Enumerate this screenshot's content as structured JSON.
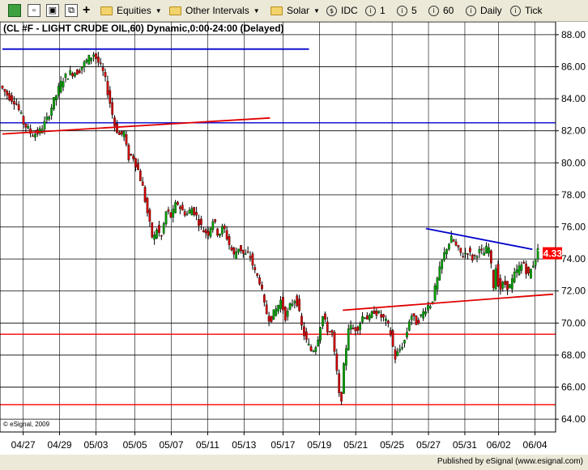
{
  "toolbar": {
    "equities": "Equities",
    "other_intervals": "Other Intervals",
    "solar": "Solar",
    "idc": "IDC",
    "int1": "1",
    "int5": "5",
    "int60": "60",
    "daily": "Daily",
    "tick": "Tick"
  },
  "footer": {
    "publisher": "Published by eSignal (www.esignal.com)"
  },
  "chart_data": {
    "type": "candlestick",
    "title": "(CL #F - LIGHT CRUDE OIL,60) Dynamic,0:00-24:00 (Delayed)",
    "copyright": "© eSignal, 2009",
    "last_price": "74.33",
    "ylim": [
      63.2,
      88.8
    ],
    "yticks": [
      "64.00",
      "66.00",
      "68.00",
      "70.00",
      "72.00",
      "74.00",
      "76.00",
      "78.00",
      "80.00",
      "82.00",
      "84.00",
      "86.00",
      "88.00"
    ],
    "xticks": [
      "04/27",
      "04/29",
      "05/03",
      "05/05",
      "05/07",
      "05/11",
      "05/13",
      "05/17",
      "05/19",
      "05/21",
      "05/25",
      "05/27",
      "05/31",
      "06/02",
      "06/04"
    ],
    "grid": true,
    "colors": {
      "up": "#00a000",
      "down": "#d00000",
      "support": "#ff0000",
      "trend_red": "#e00000",
      "trend_blue": "#0000cc",
      "last_badge": "#ff0000"
    },
    "price_path": [
      [
        0.0,
        84.8
      ],
      [
        3.0,
        84.2
      ],
      [
        6.0,
        83.8
      ],
      [
        9.0,
        82.5
      ],
      [
        12.0,
        81.8
      ],
      [
        15.0,
        81.9
      ],
      [
        18.0,
        82.7
      ],
      [
        21.0,
        84.0
      ],
      [
        24.0,
        85.2
      ],
      [
        27.0,
        85.6
      ],
      [
        30.0,
        85.7
      ],
      [
        32.0,
        86.1
      ],
      [
        34.0,
        86.5
      ],
      [
        36.0,
        86.8
      ],
      [
        38.0,
        86.2
      ],
      [
        40.0,
        85.5
      ],
      [
        42.0,
        84.0
      ],
      [
        44.0,
        82.4
      ],
      [
        46.0,
        81.7
      ],
      [
        48.0,
        81.9
      ],
      [
        49.0,
        80.3
      ],
      [
        51.0,
        80.5
      ],
      [
        53.0,
        79.6
      ],
      [
        55.0,
        78.4
      ],
      [
        57.0,
        76.6
      ],
      [
        59.0,
        75.0
      ],
      [
        60.0,
        76.0
      ],
      [
        62.0,
        75.3
      ],
      [
        64.0,
        77.0
      ],
      [
        66.0,
        76.6
      ],
      [
        68.0,
        77.6
      ],
      [
        70.0,
        77.0
      ],
      [
        72.0,
        76.8
      ],
      [
        74.0,
        77.2
      ],
      [
        76.0,
        76.5
      ],
      [
        78.0,
        75.8
      ],
      [
        80.0,
        75.6
      ],
      [
        82.0,
        76.5
      ],
      [
        84.0,
        75.5
      ],
      [
        86.0,
        76.0
      ],
      [
        88.0,
        75.0
      ],
      [
        90.0,
        74.2
      ],
      [
        92.0,
        74.8
      ],
      [
        94.0,
        74.2
      ],
      [
        96.0,
        74.3
      ],
      [
        98.0,
        73.2
      ],
      [
        100.0,
        72.6
      ],
      [
        102.0,
        70.8
      ],
      [
        104.0,
        70.2
      ],
      [
        106.0,
        70.8
      ],
      [
        108.0,
        71.4
      ],
      [
        110.0,
        70.3
      ],
      [
        112.0,
        71.2
      ],
      [
        114.0,
        71.6
      ],
      [
        116.0,
        69.8
      ],
      [
        118.0,
        68.8
      ],
      [
        120.0,
        68.2
      ],
      [
        122.0,
        68.8
      ],
      [
        124.0,
        70.5
      ],
      [
        126.0,
        69.6
      ],
      [
        128.0,
        69.3
      ],
      [
        129.0,
        67.5
      ],
      [
        130.0,
        66.5
      ],
      [
        131.0,
        64.4
      ],
      [
        132.0,
        66.8
      ],
      [
        133.0,
        68.2
      ],
      [
        134.0,
        69.8
      ],
      [
        136.0,
        69.6
      ],
      [
        138.0,
        69.8
      ],
      [
        140.0,
        70.6
      ],
      [
        142.0,
        70.2
      ],
      [
        144.0,
        70.8
      ],
      [
        146.0,
        70.5
      ],
      [
        148.0,
        70.2
      ],
      [
        150.0,
        69.6
      ],
      [
        152.0,
        67.8
      ],
      [
        154.0,
        68.4
      ],
      [
        156.0,
        69.0
      ],
      [
        158.0,
        70.6
      ],
      [
        160.0,
        70.0
      ],
      [
        162.0,
        70.4
      ],
      [
        164.0,
        71.0
      ],
      [
        166.0,
        71.2
      ],
      [
        168.0,
        72.5
      ],
      [
        170.0,
        73.8
      ],
      [
        172.0,
        74.8
      ],
      [
        174.0,
        75.3
      ],
      [
        176.0,
        74.6
      ],
      [
        178.0,
        74.2
      ],
      [
        180.0,
        74.5
      ],
      [
        182.0,
        74.0
      ],
      [
        184.0,
        74.5
      ],
      [
        186.0,
        74.3
      ],
      [
        188.0,
        74.8
      ],
      [
        189.0,
        73.5
      ],
      [
        190.0,
        72.2
      ],
      [
        191.0,
        73.8
      ],
      [
        192.0,
        72.0
      ],
      [
        194.0,
        72.5
      ],
      [
        196.0,
        72.2
      ],
      [
        198.0,
        73.0
      ],
      [
        200.0,
        73.5
      ],
      [
        202.0,
        73.8
      ],
      [
        203.0,
        72.8
      ],
      [
        205.0,
        73.6
      ],
      [
        207.0,
        74.5
      ]
    ],
    "horizontal_lines": [
      {
        "value": 82.5,
        "color": "#0000cc"
      },
      {
        "value": 69.3,
        "color": "#ff0000"
      },
      {
        "value": 64.9,
        "color": "#ff0000"
      }
    ],
    "trend_lines": [
      {
        "x": [
          0,
          103
        ],
        "y": [
          81.8,
          82.8
        ],
        "color": "#e00000"
      },
      {
        "x": [
          131,
          212
        ],
        "y": [
          70.8,
          71.8
        ],
        "color": "#e00000"
      },
      {
        "x": [
          163,
          204
        ],
        "y": [
          75.9,
          74.6
        ],
        "color": "#0000cc"
      },
      {
        "x": [
          0,
          118
        ],
        "y": [
          87.1,
          87.1
        ],
        "color": "#0000cc"
      }
    ],
    "xtick_positions": [
      8,
      22,
      36,
      51,
      65,
      79,
      93,
      108,
      122,
      136,
      150,
      164,
      178,
      191,
      205
    ],
    "xlim": [
      0,
      212
    ]
  }
}
